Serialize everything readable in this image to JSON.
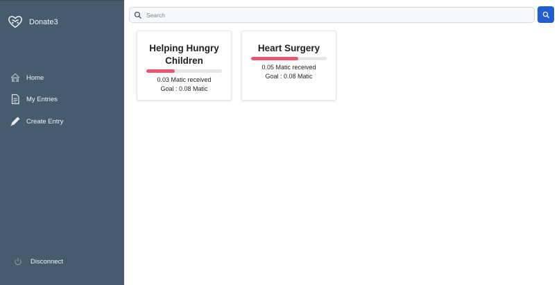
{
  "sidebar": {
    "brand": "Donate3",
    "items": [
      {
        "label": "Home",
        "icon": "home-icon"
      },
      {
        "label": "My Entries",
        "icon": "document-icon"
      },
      {
        "label": "Create Entry",
        "icon": "pen-icon"
      }
    ],
    "disconnect": {
      "label": "Disconnect",
      "icon": "power-icon"
    }
  },
  "search": {
    "placeholder": "Search",
    "value": ""
  },
  "cards": [
    {
      "title": "Helping Hungry Children",
      "received": "0.03 Matic received",
      "goal": "Goal : 0.08 Matic",
      "progress": 0.375
    },
    {
      "title": "Heart Surgery",
      "received": "0.05 Matic received",
      "goal": "Goal : 0.08 Matic",
      "progress": 0.625
    }
  ],
  "colors": {
    "sidebar_bg": "#475b6f",
    "accent": "#1f5fcf",
    "progress": "#e9566f"
  }
}
